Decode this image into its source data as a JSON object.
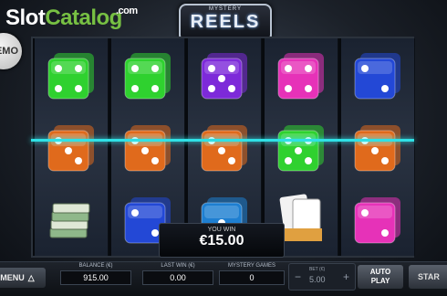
{
  "watermark": {
    "part1": "Slot",
    "part2": "Catalog",
    "suffix": ".com"
  },
  "demo_badge": "EMO",
  "logo": {
    "small": "MYSTERY",
    "main": "REELS"
  },
  "reels": [
    [
      {
        "symbol": "dice",
        "color": "#2fd12f",
        "pips": 4
      },
      {
        "symbol": "dice",
        "color": "#e06a1c",
        "pips": 3
      },
      {
        "symbol": "cash-stack-icon",
        "color": "#8fb88a",
        "pips": 0
      }
    ],
    [
      {
        "symbol": "dice",
        "color": "#2fd12f",
        "pips": 4
      },
      {
        "symbol": "dice",
        "color": "#e06a1c",
        "pips": 3
      },
      {
        "symbol": "dice",
        "color": "#2348d6",
        "pips": 2
      }
    ],
    [
      {
        "symbol": "dice",
        "color": "#7d2ad9",
        "pips": 5
      },
      {
        "symbol": "dice",
        "color": "#e06a1c",
        "pips": 3
      },
      {
        "symbol": "dice",
        "color": "#1e7fd1",
        "pips": 1
      }
    ],
    [
      {
        "symbol": "dice",
        "color": "#e632b8",
        "pips": 4
      },
      {
        "symbol": "dice",
        "color": "#2fd12f",
        "pips": 5
      },
      {
        "symbol": "wild-cards-icon",
        "color": "#e0a040",
        "pips": 0
      }
    ],
    [
      {
        "symbol": "dice",
        "color": "#2348d6",
        "pips": 2
      },
      {
        "symbol": "dice",
        "color": "#e06a1c",
        "pips": 3
      },
      {
        "symbol": "dice",
        "color": "#e632b8",
        "pips": 2
      }
    ]
  ],
  "win": {
    "label": "YOU WIN",
    "amount": "€15.00"
  },
  "bottom": {
    "menu_label": "MENU",
    "balance_label": "BALANCE (€)",
    "balance": "915.00",
    "last_win_label": "LAST WIN (€)",
    "last_win": "0.00",
    "mystery_label": "MYSTERY GAMES",
    "mystery": "0",
    "bet_label": "BET (€)",
    "bet": "5.00",
    "auto_label_1": "AUTO",
    "auto_label_2": "PLAY",
    "start_label": "STAR"
  },
  "colors": {
    "payline": "#2fe1e6",
    "brand_green": "#77c043"
  }
}
